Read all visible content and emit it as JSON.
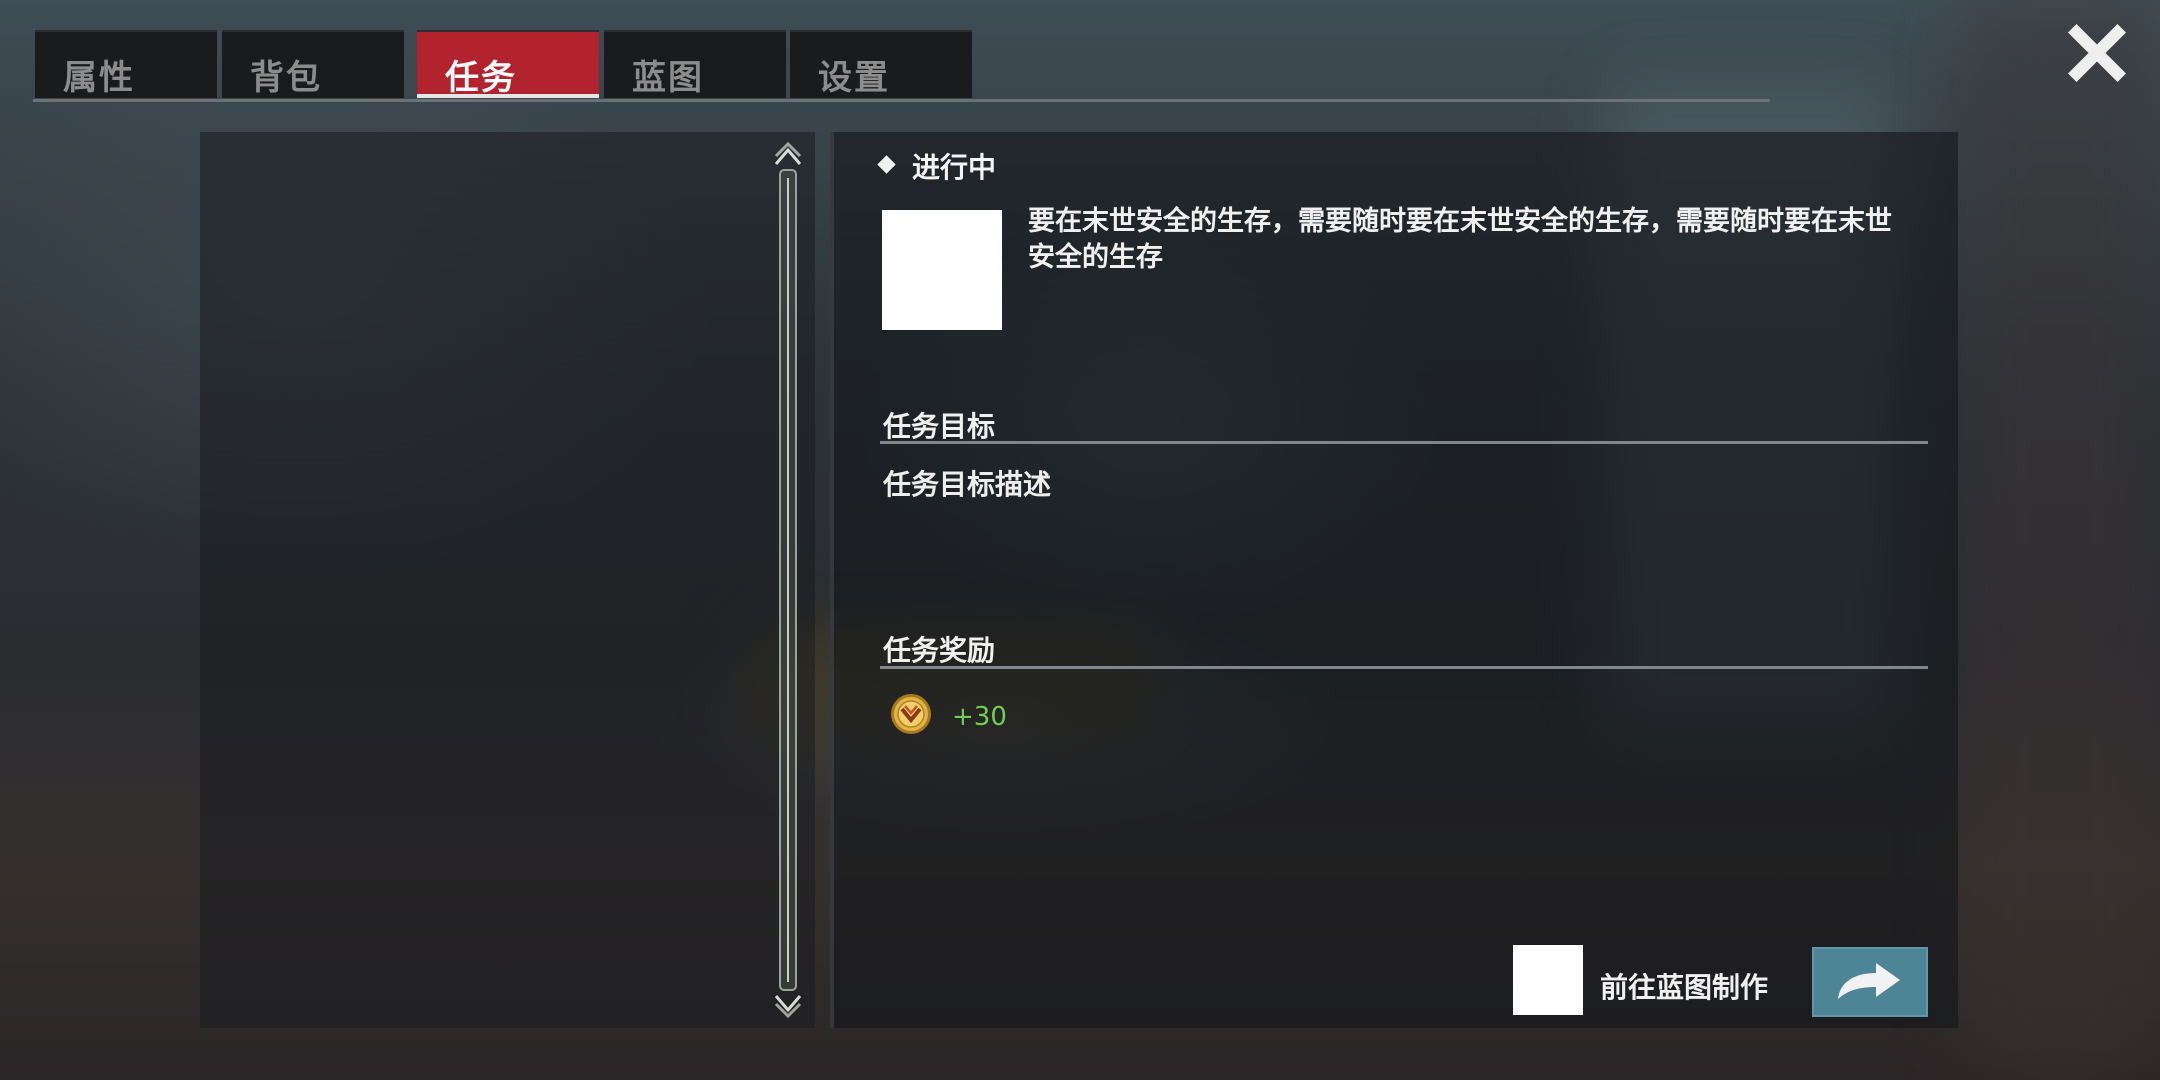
{
  "tabs": [
    {
      "label": "属性",
      "active": false
    },
    {
      "label": "背包",
      "active": false
    },
    {
      "label": "任务",
      "active": true
    },
    {
      "label": "蓝图",
      "active": false
    },
    {
      "label": "设置",
      "active": false
    }
  ],
  "close_icon": "close-x-icon",
  "quest": {
    "status": "进行中",
    "description": "要在末世安全的生存，需要随时要在末世安全的生存，需要随时要在末世安全的生存",
    "goal_title": "任务目标",
    "goal_description": "任务目标描述",
    "reward_title": "任务奖励",
    "reward_icon": "gold-medal-coin-icon",
    "reward_amount": "+30",
    "goto_label": "前往蓝图制作",
    "goto_button_icon": "arrow-redirect-icon"
  },
  "colors": {
    "active_tab": "#b3232e",
    "reward_text": "#6fcf52",
    "goto_button": "#4d8597"
  }
}
